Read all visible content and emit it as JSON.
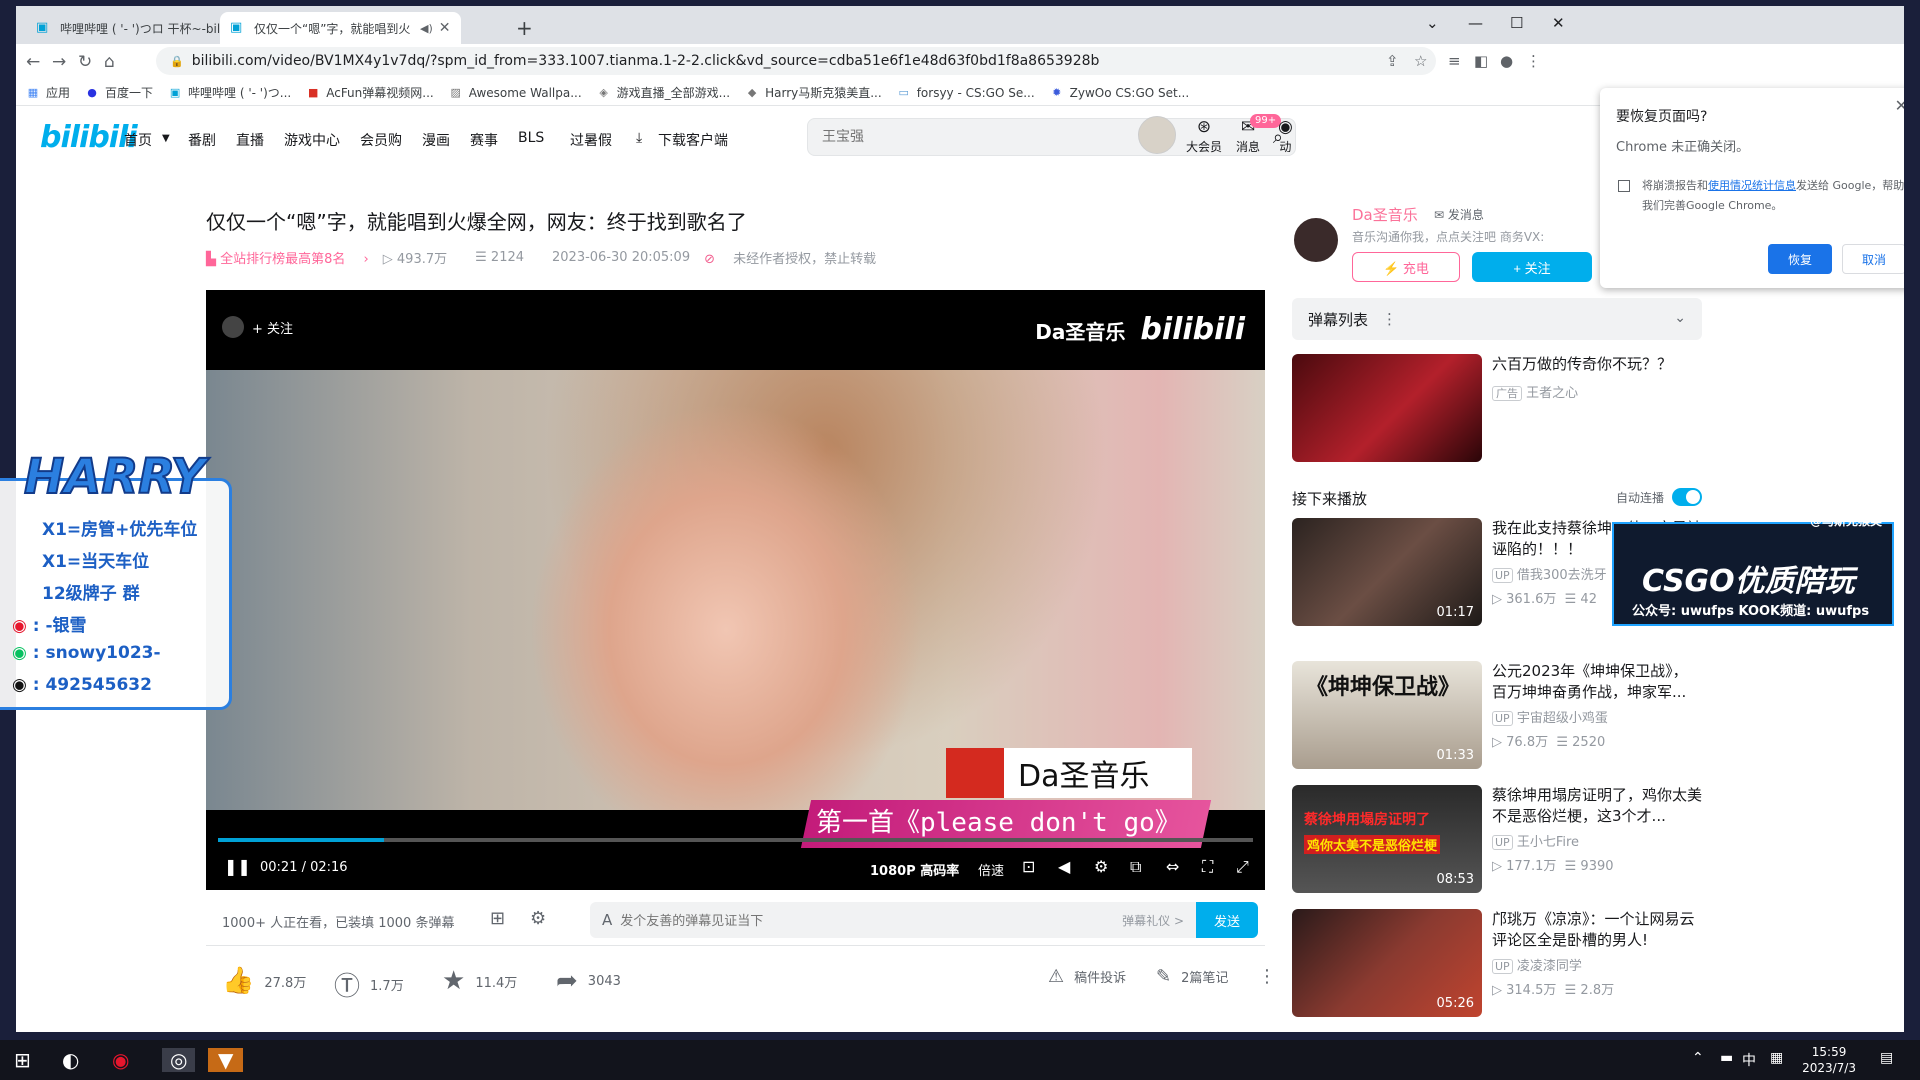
{
  "browser": {
    "tabs": [
      {
        "title": "哔哩哔哩 ( '- ')つロ 干杯~-bili",
        "active": false
      },
      {
        "title": "仅仅一个“嗯”字，就能唱到火",
        "active": true
      }
    ],
    "url": "bilibili.com/video/BV1MX4y1v7dq/?spm_id_from=333.1007.tianma.1-2-2.click&vd_source=cdba51e6f1e48d63f0bd1f8a8653928b",
    "bookmarks": [
      "应用",
      "百度一下",
      "哔哩哔哩 ( '- ')つ...",
      "AcFun弹幕视频网...",
      "Awesome Wallpa...",
      "游戏直播_全部游戏...",
      "Harry马斯克猿美直...",
      "forsyy - CS:GO Se...",
      "ZywOo CS:GO Set..."
    ]
  },
  "header": {
    "logo": "bilibili",
    "nav": [
      "首页",
      "番剧",
      "直播",
      "游戏中心",
      "会员购",
      "漫画",
      "赛事",
      "BLS",
      "过暑假",
      "下载客户端"
    ],
    "search_placeholder": "王宝强",
    "right": {
      "vip": "大会员",
      "messages": "消息",
      "messages_badge": "99+",
      "dyn": "动"
    }
  },
  "video": {
    "title": "仅仅一个“嗯”字，就能唱到火爆全网，网友：终于找到歌名了",
    "rank": "全站排行榜最高第8名",
    "views": "493.7万",
    "danmaku_count": "2124",
    "date": "2023-06-30 20:05:09",
    "notice": "未经作者授权，禁止转载"
  },
  "player": {
    "follow": "+ 关注",
    "watermark": "Da圣音乐",
    "watermark_logo": "bilibili",
    "caption_name": "Da圣音乐",
    "song": "第一首《please don't go》",
    "time": "00:21 / 02:16",
    "progress": 0.16,
    "quality": "1080P 高码率",
    "speed": "倍速"
  },
  "danmaku": {
    "online": "1000+ 人正在看，已装填 1000 条弹幕",
    "placeholder": "发个友善的弹幕见证当下",
    "etiquette": "弹幕礼仪 >",
    "send": "发送"
  },
  "actions": {
    "like": "27.8万",
    "coin": "1.7万",
    "favorite": "11.4万",
    "share": "3043",
    "report": "稿件投诉",
    "notes": "2篇笔记"
  },
  "uploader": {
    "name": "Da圣音乐",
    "message": "发消息",
    "desc": "音乐沟通你我，点点关注吧 商务VX:",
    "charge": "充电",
    "follow": "+ 关注"
  },
  "sidebar": {
    "danmaku_list": "弹幕列表",
    "next_label": "接下来播放",
    "autoplay": "自动连播",
    "ad": {
      "title": "六百万做的传奇你不玩？？",
      "tag": "广告",
      "author": "王者之心"
    },
    "recs": [
      {
        "title": "我在此支持蔡徐坤，他一定是被诬陷的！！！",
        "author": "借我300去洗牙",
        "views": "361.6万",
        "dm": "42",
        "duration": "01:17"
      },
      {
        "title": "公元2023年《坤坤保卫战》，百万坤坤奋勇作战，坤家军...",
        "author": "宇宙超级小鸡蛋",
        "views": "76.8万",
        "dm": "2520",
        "duration": "01:33"
      },
      {
        "title": "蔡徐坤用塌房证明了，鸡你太美不是恶俗烂梗，这3个才...",
        "author": "王小七Fire",
        "views": "177.1万",
        "dm": "9390",
        "duration": "08:53"
      },
      {
        "title": "邝珧万《凉凉》：一个让网易云评论区全是卧槽的男人!",
        "author": "凌凌漆同学",
        "views": "314.5万",
        "dm": "2.8万",
        "duration": "05:26"
      }
    ],
    "thumb_text_1": "《坤坤保卫战》",
    "thumb_text_2": "蔡徐坤用塌房证明了",
    "thumb_text_3": "鸡你太美不是恶俗烂梗"
  },
  "restore_popup": {
    "title": "要恢复页面吗?",
    "subtitle": "Chrome 未正确关闭。",
    "desc_prefix": "将崩溃报告和",
    "desc_link": "使用情况统计信息",
    "desc_suffix": "发送给 Google，帮助我们完善Google Chrome。",
    "restore": "恢复",
    "cancel": "取消"
  },
  "overlay": {
    "harry_logo": "HARRY",
    "lines": [
      "X1=房管+优先车位",
      "X1=当天车位",
      "12级牌子 群",
      ": -银雪",
      ": snowy1023-",
      ": 492545632"
    ],
    "csgo_top": "@马斯克猴类",
    "csgo_main": "CSGO优质陪玩",
    "csgo_sub": "公众号: uwufps KOOK频道: uwufps"
  },
  "taskbar": {
    "time": "15:59",
    "date": "2023/7/3",
    "ime": "中"
  },
  "colors": {
    "bili_blue": "#00aeec",
    "bili_pink": "#fb7299",
    "chrome_blue": "#1a73e8"
  }
}
